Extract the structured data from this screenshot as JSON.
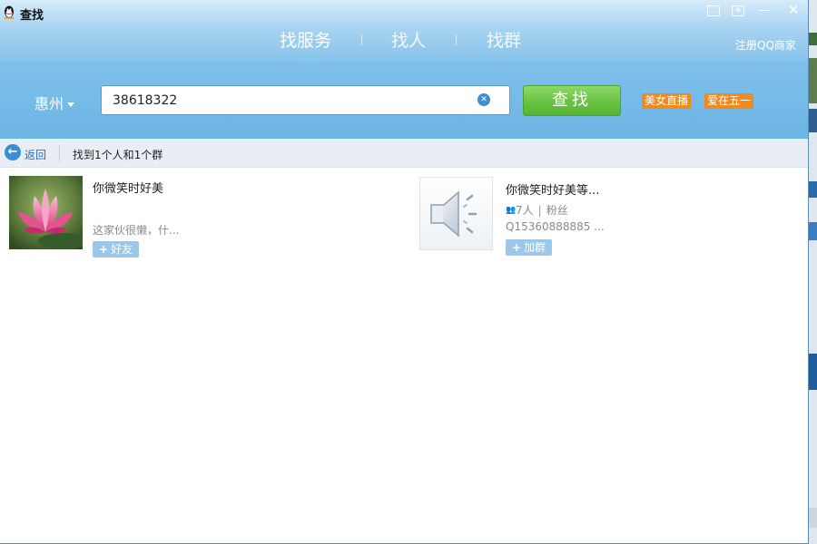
{
  "window": {
    "title": "查找"
  },
  "tabs": [
    {
      "label": "找服务",
      "active": true
    },
    {
      "label": "找人",
      "active": false
    },
    {
      "label": "找群",
      "active": false
    }
  ],
  "header": {
    "register_label": "注册QQ商家"
  },
  "search": {
    "city": "惠州",
    "query": "38618322",
    "button_label": "查找"
  },
  "promos": [
    {
      "label": "美女直播"
    },
    {
      "label": "爱在五一"
    }
  ],
  "subbar": {
    "back_label": "返回",
    "result_summary": "找到1个人和1个群"
  },
  "person_result": {
    "name": "你微笑时好美",
    "signature": "这家伙很懒，什...",
    "add_label": "好友",
    "avatar_icon": "lotus-photo"
  },
  "group_result": {
    "name": "你微笑时好美等...",
    "members": "7人",
    "category": "粉丝",
    "group_id": "Q15360888885 ...",
    "add_label": "加群",
    "avatar_icon": "speaker-icon"
  },
  "colors": {
    "header_blue": "#6fb3e3",
    "search_green": "#6cc446",
    "promo_orange": "#f08a1c",
    "link_blue": "#2a6fb3"
  }
}
